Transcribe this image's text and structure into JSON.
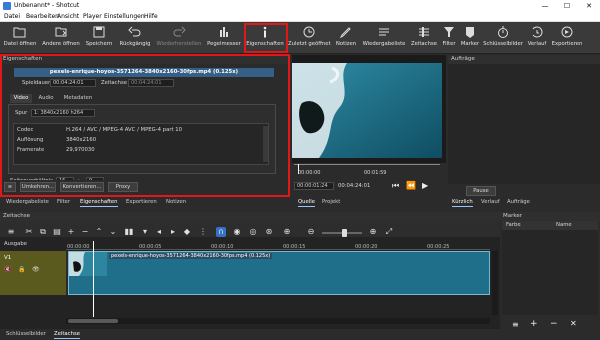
{
  "window": {
    "title": "Unbenannt* - Shotcut",
    "controls": [
      "—",
      "☐",
      "✕"
    ]
  },
  "menu": [
    "Datei",
    "Bearbeiten",
    "Ansicht",
    "Player",
    "Einstellungen",
    "Hilfe"
  ],
  "toolbar": {
    "open_file": "Datei öffnen",
    "open_other": "Andere öffnen",
    "save": "Speichern",
    "undo": "Rückgängig",
    "redo": "Wiederherstellen",
    "peak_meter": "Pegelmesser",
    "properties": "Eigenschaften",
    "recent": "Zuletzt geöffnet",
    "notes": "Notizen",
    "playlist": "Wiedergabeliste",
    "timeline": "Zeitachse",
    "filters": "Filter",
    "markers": "Marker",
    "keyframes": "Schlüsselbilder",
    "history": "Verlauf",
    "export": "Exportieren"
  },
  "properties": {
    "panel_title": "Eigenschaften",
    "clip_name": "pexels-enrique-hoyos-3571264-3840x2160-30fps.mp4 (0.125x)",
    "duration_label": "Spieldauer",
    "duration_value": "00:04:24:01",
    "timeline_label": "Zeitachse",
    "timeline_value": "00:04:24:01",
    "tabs": [
      "Video",
      "Audio",
      "Metadaten"
    ],
    "track_label": "Spur",
    "track_value": "1: 3840x2160 h264",
    "rows": [
      {
        "key": "Codec",
        "value": "H.264 / AVC / MPEG-4 AVC / MPEG-4 part 10"
      },
      {
        "key": "Auflösung",
        "value": "3840x2160"
      },
      {
        "key": "Framerate",
        "value": "29,970030"
      }
    ],
    "aspect_label": "Seitenverhältnis",
    "aspect_w": "16",
    "aspect_h": "9",
    "buttons": {
      "reverse": "Umkehren...",
      "convert": "Konvertieren...",
      "proxy": "Proxy"
    }
  },
  "player": {
    "time_left": "00:00:00",
    "time_mid": "00:01:59",
    "current": "00:00:01:24",
    "total": "00:04:24:01",
    "source_tab": "Quelle",
    "project_tab": "Projekt"
  },
  "jobs": {
    "title": "Aufträge",
    "pause": "Pause"
  },
  "left_bottom_tabs": [
    "Wiedergabeliste",
    "Filter",
    "Eigenschaften",
    "Exportieren",
    "Notizen"
  ],
  "right_bottom_tabs": [
    "Kürzlich",
    "Verlauf",
    "Aufträge"
  ],
  "timeline": {
    "title": "Zeitachse",
    "output_label": "Ausgabe",
    "track": "V1",
    "ticks": [
      "00:00:00",
      "00:00:05",
      "00:00:10",
      "00:00:15",
      "00:00:20",
      "00:00:25"
    ],
    "clip_label": "pexels-enrique-hoyos-3571264-3840x2160-30fps.mp4 (0.125x)"
  },
  "markers": {
    "title": "Marker",
    "col_color": "Farbe",
    "col_name": "Name"
  },
  "bottom_tabs": [
    "Schlüsselbilder",
    "Zeitachse"
  ],
  "colors": {
    "accent": "#e01818",
    "clip": "#1f6f8b",
    "track_header": "#5a5a1e",
    "toolbar": "#3a3a3a"
  }
}
